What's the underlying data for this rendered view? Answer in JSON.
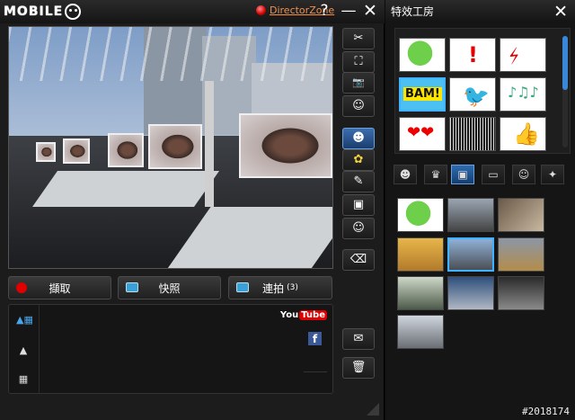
{
  "app": {
    "logo_text": "MOBILE",
    "director_zone": "DirectorZone",
    "help_symbol": "?",
    "minimize_symbol": "—",
    "close_symbol": "✕"
  },
  "capture": {
    "record_label": "擷取",
    "snapshot_label": "快照",
    "burst_label": "連拍",
    "burst_count": "(3)"
  },
  "share": {
    "youtube_prefix": "You",
    "youtube_tube": "Tube",
    "facebook": "f"
  },
  "effects_panel": {
    "title": "特效工房",
    "close_symbol": "✕"
  },
  "tools": {
    "settings_icon": "✂",
    "fullscreen_icon": "⛶",
    "camera_icon": "📷",
    "avatar_add_icon": "☺",
    "effects_icon": "☻",
    "flower_icon": "✿",
    "pen_icon": "✎",
    "frame_icon": "▣",
    "people_icon": "☺",
    "eraser_icon": "⌫",
    "mail_icon": "✉",
    "trash_icon": "🗑"
  },
  "tabs": [
    {
      "icon": "☻"
    },
    {
      "icon": "♛"
    },
    {
      "icon": "▣"
    },
    {
      "icon": "▭"
    },
    {
      "icon": "☺"
    },
    {
      "icon": "✦"
    }
  ],
  "watermark": "#2018174",
  "colors": {
    "accent_blue": "#3a86d8",
    "record_red": "#e00000",
    "director_link": "#f09050"
  }
}
